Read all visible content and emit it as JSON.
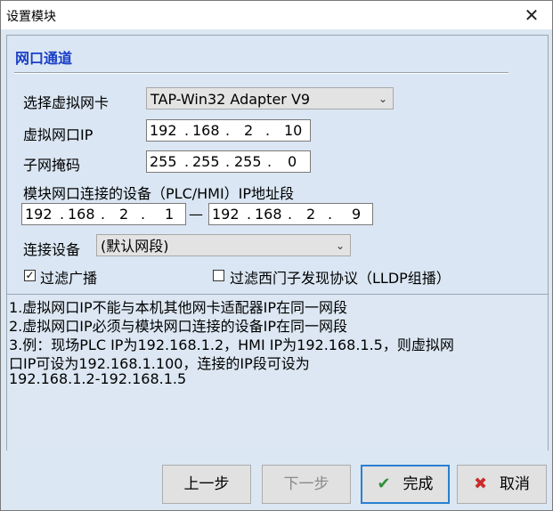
{
  "window": {
    "title": "设置模块",
    "close_glyph": "✕"
  },
  "section": {
    "title": "网口通道"
  },
  "adapter": {
    "label": "选择虚拟网卡",
    "value": "TAP-Win32 Adapter V9"
  },
  "virtual_ip": {
    "label": "虚拟网口IP",
    "octets": [
      "192",
      "168",
      "2",
      "10"
    ]
  },
  "subnet": {
    "label": "子网掩码",
    "octets": [
      "255",
      "255",
      "255",
      "0"
    ]
  },
  "range": {
    "label": "模块网口连接的设备（PLC/HMI）IP地址段",
    "separator": "—",
    "start": [
      "192",
      "168",
      "2",
      "1"
    ],
    "end": [
      "192",
      "168",
      "2",
      "9"
    ]
  },
  "device": {
    "label": "连接设备",
    "value": "(默认网段)"
  },
  "filters": {
    "broadcast": {
      "label": "过滤广播",
      "checked": true,
      "mark": "✓"
    },
    "lldp": {
      "label": "过滤西门子发现协议（LLDP组播）",
      "checked": false
    }
  },
  "notes": [
    "1.虚拟网口IP不能与本机其他网卡适配器IP在同一网段",
    "2.虚拟网口IP必须与模块网口连接的设备IP在同一网段",
    "3.例：现场PLC IP为192.168.1.2，HMI IP为192.168.1.5，则虚拟网",
    "口IP可设为192.168.1.100，连接的IP段可设为",
    "192.168.1.2-192.168.1.5"
  ],
  "buttons": {
    "prev": "上一步",
    "next": "下一步",
    "finish": "完成",
    "cancel": "取消",
    "finish_icon": "✔",
    "cancel_icon": "✖"
  },
  "colors": {
    "section_title": "#1a3fc8",
    "finish_icon": "#2f8f3a",
    "cancel_icon": "#cc2b2b",
    "primary_border": "#2a7fd1"
  }
}
